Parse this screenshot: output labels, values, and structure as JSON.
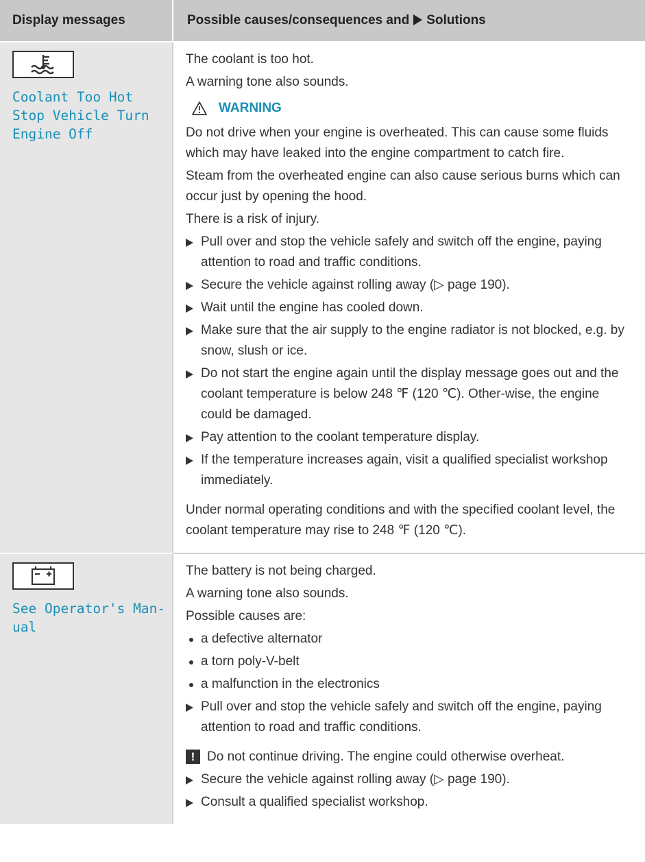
{
  "header": {
    "col1": "Display messages",
    "col2_prefix": "Possible causes/consequences and",
    "col2_suffix": "Solutions",
    "solutions_icon": "triangle-right-icon"
  },
  "rows": [
    {
      "icon": "coolant-temperature-icon",
      "message_lines": [
        "Coolant Too Hot",
        "Stop Vehicle Turn",
        "Engine Off"
      ],
      "intro": [
        "The coolant is too hot.",
        "A warning tone also sounds."
      ],
      "warning": {
        "icon": "warning-triangle-icon",
        "label": "WARNING",
        "paragraphs": [
          "Do not drive when your engine is overheated. This can cause some fluids which may have leaked into the engine compartment to catch fire.",
          "Steam from the overheated engine can also cause serious burns which can occur just by opening the hood.",
          "There is a risk of injury."
        ]
      },
      "steps": [
        "Pull over and stop the vehicle safely and switch off the engine, paying attention to road and traffic conditions.",
        "Secure the vehicle against rolling away (▷ page 190).",
        "Wait until the engine has cooled down.",
        "Make sure that the air supply to the engine radiator is not blocked, e.g. by snow, slush or ice.",
        "Do not start the engine again until the display message goes out and the coolant temperature is below 248 ℉ (120 ℃). Other-wise, the engine could be damaged.",
        "Pay attention to the coolant temperature display.",
        "If the temperature increases again, visit a qualified specialist workshop immediately."
      ],
      "closing": "Under normal operating conditions and with the specified coolant level, the coolant temperature may rise to 248 ℉ (120 ℃)."
    },
    {
      "icon": "battery-icon",
      "message_lines": [
        "See Operator's Man-",
        "ual"
      ],
      "intro": [
        "The battery is not being charged.",
        "A warning tone also sounds.",
        "Possible causes are:"
      ],
      "causes": [
        "a defective alternator",
        "a torn poly-V-belt",
        "a malfunction in the electronics"
      ],
      "step_first": "Pull over and stop the vehicle safely and switch off the engine, paying attention to road and traffic conditions.",
      "note": {
        "icon": "exclamation-icon",
        "text": "Do not continue driving. The engine could otherwise overheat."
      },
      "steps_after": [
        "Secure the vehicle against rolling away (▷ page 190).",
        "Consult a qualified specialist workshop."
      ]
    }
  ]
}
